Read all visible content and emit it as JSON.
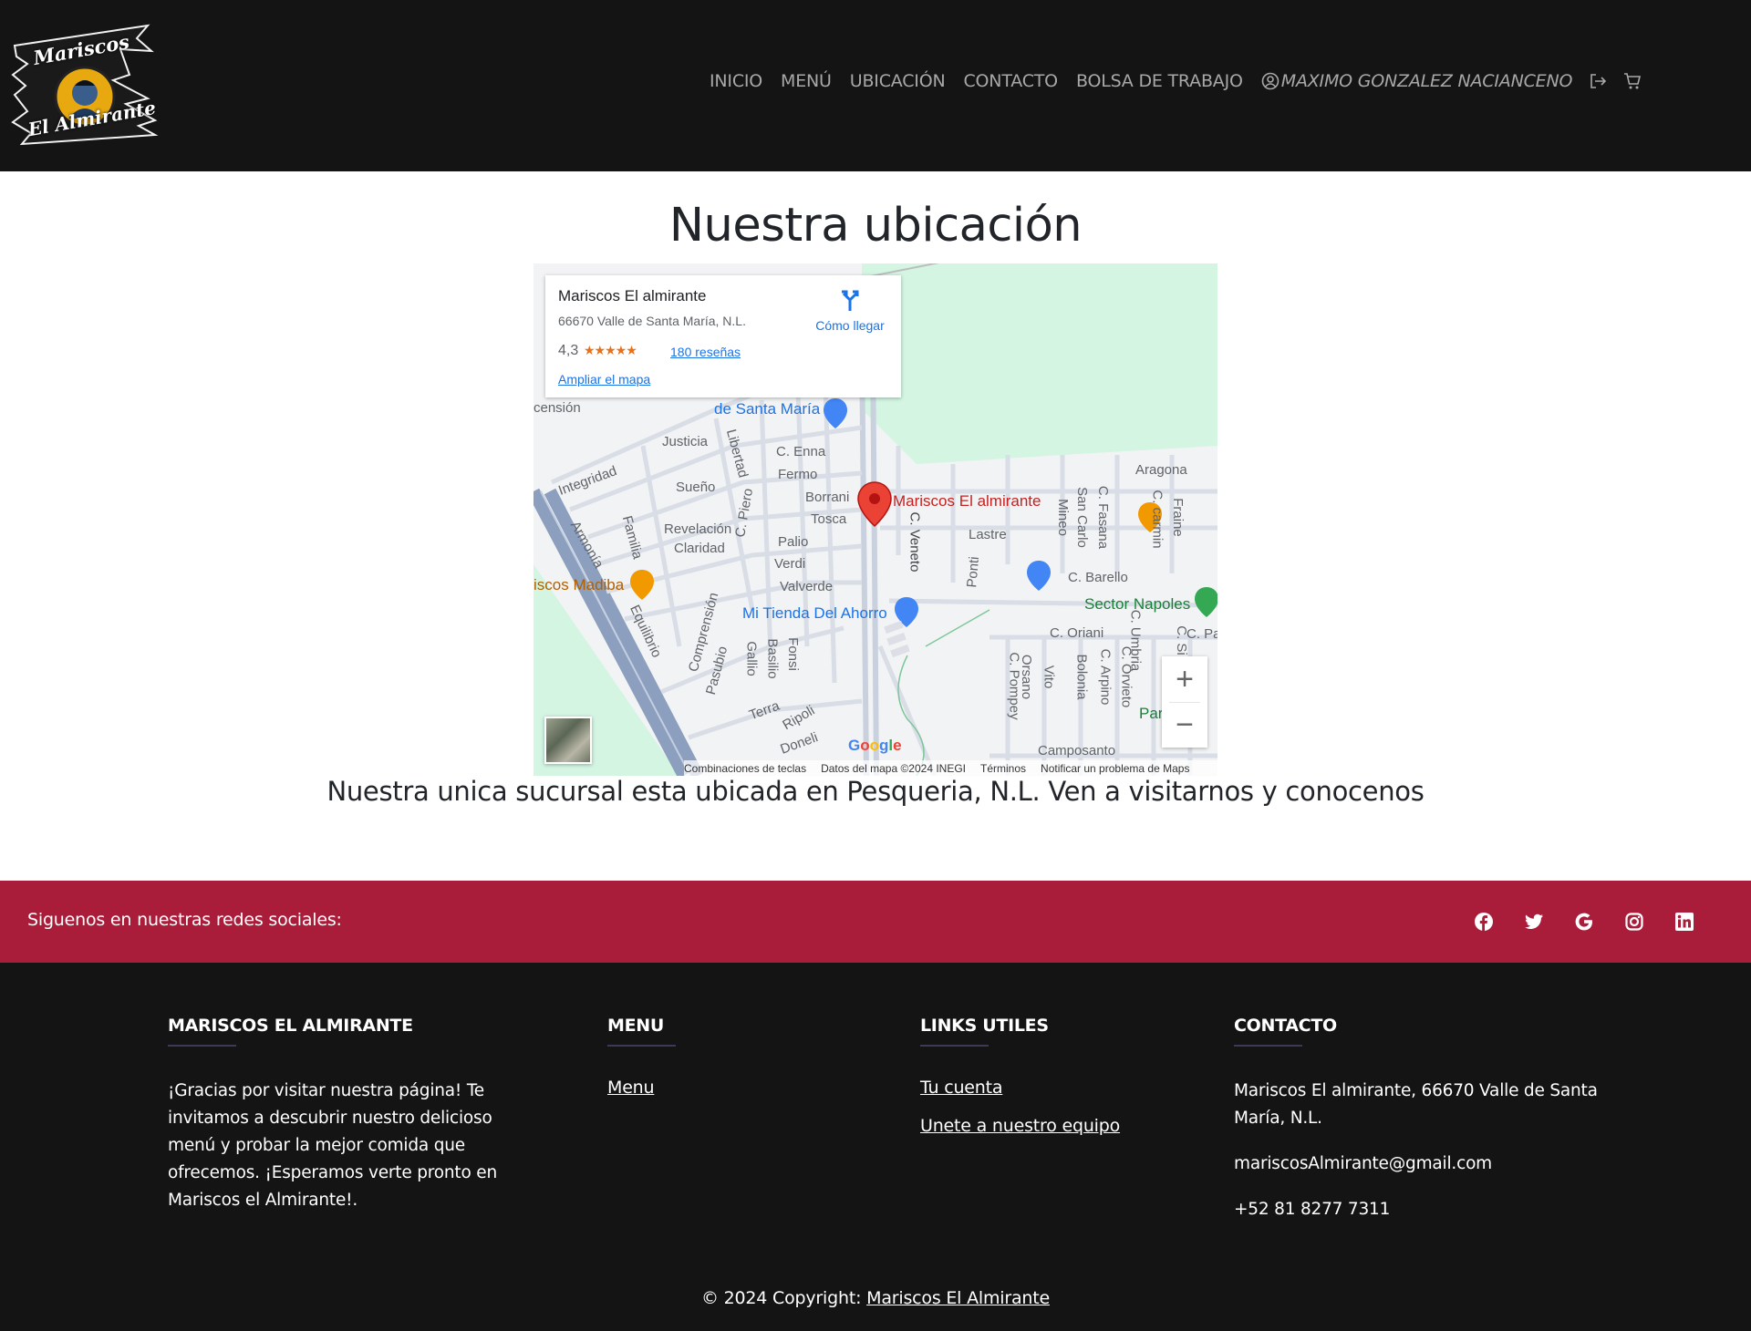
{
  "navbar": {
    "logo_line1": "Mariscos",
    "logo_line2": "El Almirante",
    "links": [
      "INICIO",
      "MENÚ",
      "UBICACIÓN",
      "CONTACTO",
      "BOLSA DE TRABAJO"
    ],
    "user_name": "MAXIMO GONZALEZ NACIANCENO",
    "icons": [
      "user-circle-icon",
      "logout-icon",
      "cart-icon"
    ]
  },
  "main": {
    "title": "Nuestra ubicación",
    "subtitle": "Nuestra unica sucursal esta ubicada en Pesqueria, N.L. Ven a visitarnos y conocenos"
  },
  "map": {
    "place_name": "Mariscos El almirante",
    "address": "66670 Valle de Santa María, N.L.",
    "rating": "4,3",
    "stars": "★★★★★",
    "rating_value": 4.3,
    "reviews": "180 reseñas",
    "enlarge": "Ampliar el mapa",
    "directions": "Cómo llegar",
    "zoom_in": "+",
    "zoom_out": "−",
    "google": "Google",
    "attribution": [
      "Combinaciones de teclas",
      "Datos del mapa ©2024 INEGI",
      "Términos",
      "Notificar un problema de Maps"
    ],
    "labels": {
      "marker": "Mariscos El almirante",
      "supermarket": "de Santa María",
      "store": "Mi Tienda Del Ahorro",
      "park": "Sector Napoles",
      "restaurant": "iscos Madiba",
      "park2": "Par",
      "streets": [
        "Justicia",
        "C. Enna",
        "Fermo",
        "Borrani",
        "Tosca",
        "Palio",
        "Verdi",
        "Valverde",
        "Sueño",
        "Integridad",
        "Revelación",
        "Claridad",
        "Armonía",
        "Familia",
        "Libertad",
        "C. Piero",
        "C. Veneto",
        "Lastre",
        "Ponti",
        "Mineo",
        "San Carlo",
        "C. Fasana",
        "Aragona",
        "C. carmin",
        "Fraine",
        "C. Barello",
        "C. Oriani",
        "C. Umbria",
        "C. Pompey",
        "Orsano",
        "Vito",
        "Bolonia",
        "C. Arpino",
        "C. Orvieto",
        "Camposanto",
        "Comprensión",
        "Pasubio",
        "Gallio",
        "Basilio",
        "Fonsi",
        "Terra",
        "Ripoli",
        "Doneli",
        "Equilibrio",
        "censión",
        "C. Pa",
        "C. Si"
      ]
    }
  },
  "social": {
    "text": "Siguenos en nuestras redes sociales:",
    "icons": [
      "facebook-icon",
      "twitter-icon",
      "google-icon",
      "instagram-icon",
      "linkedin-icon"
    ]
  },
  "footer": {
    "col1": {
      "title": "MARISCOS EL ALMIRANTE",
      "text": "¡Gracias por visitar nuestra página! Te invitamos a descubrir nuestro delicioso menú y probar la mejor comida que ofrecemos. ¡Esperamos verte pronto en Mariscos el Almirante!."
    },
    "col2": {
      "title": "MENU",
      "links": [
        "Menu"
      ]
    },
    "col3": {
      "title": "LINKS UTILES",
      "links": [
        "Tu cuenta",
        "Unete a nuestro equipo"
      ]
    },
    "col4": {
      "title": "CONTACTO",
      "address": "Mariscos El almirante, 66670 Valle de Santa María, N.L.",
      "email": "mariscosAlmirante@gmail.com",
      "phone": "+52 81 8277 7311"
    },
    "copyright_prefix": "© 2024 Copyright: ",
    "copyright_link": "Mariscos El Almirante"
  },
  "colors": {
    "navbar_bg": "#141414",
    "social_bg": "#a91d3a",
    "footer_bg": "#141414",
    "map_link": "#1a73e8",
    "marker": "#ea4335"
  }
}
